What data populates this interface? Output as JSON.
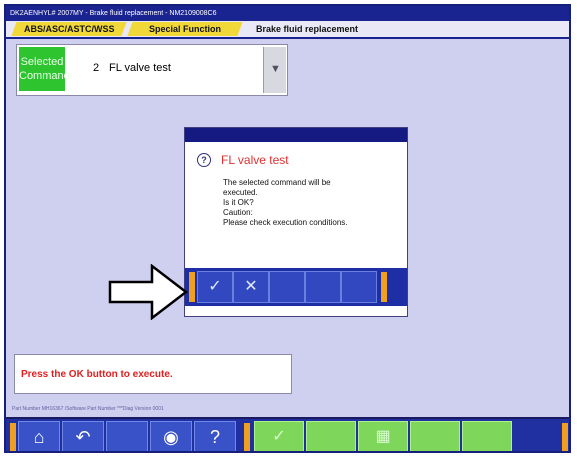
{
  "window": {
    "title": "DK2AENHYL# 2007MY   -   Brake fluid replacement   -   NM2109008C6"
  },
  "tabs": [
    {
      "label": "ABS/ASC/ASTC/WSS"
    },
    {
      "label": "Special Function"
    },
    {
      "label": "Brake fluid replacement"
    }
  ],
  "selected_command": {
    "label": "Selected\nCommand",
    "number": "2",
    "name": "FL valve test"
  },
  "dialog": {
    "heading": "FL valve test",
    "message_lines": [
      "The selected command will be",
      "executed.",
      "Is it OK?",
      "Caution:",
      "Please check execution conditions."
    ],
    "buttons": [
      {
        "icon": "check-icon"
      },
      {
        "icon": "cross-icon"
      }
    ]
  },
  "status": {
    "message": "Press the OK button to execute."
  },
  "part_number_line": "Part Number MH16367 /Software Part Number ***Diag  Version 0001",
  "toolbar": {
    "buttons": [
      "home-icon",
      "back-icon",
      "disc-icon",
      "help-icon",
      "check-icon",
      "data-icon"
    ]
  },
  "colors": {
    "accent_yellow": "#f0d838",
    "selected_green": "#2ec430",
    "dialog_title": "#151a82",
    "heading_red": "#e03030",
    "status_red": "#e02020",
    "bar_blue": "#2030a0"
  }
}
